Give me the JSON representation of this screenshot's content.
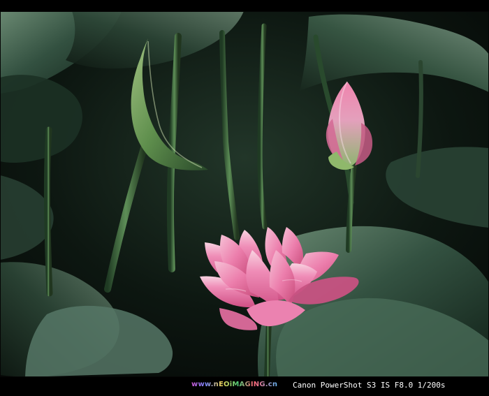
{
  "image": {
    "site_watermark": "www.nEOiMAGING.cn",
    "camera_info": "Canon PowerShot S3 IS F8.0 1/200s",
    "colors": {
      "frame": "#000000",
      "caption_text": "#ffffff",
      "leaf_dark": "#122319",
      "leaf_mid": "#2b4737",
      "leaf_light": "#5d7f68",
      "stem": "#3f6a40",
      "lotus_pink": "#ef82b0",
      "lotus_light": "#f7c7d9",
      "lotus_dark": "#c8527d",
      "bud_green": "#8bb06a"
    }
  }
}
